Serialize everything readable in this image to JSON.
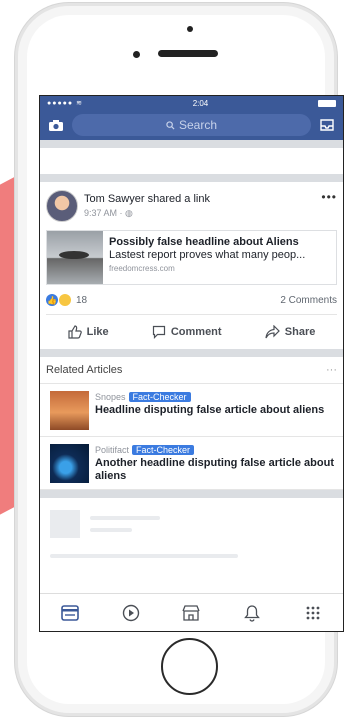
{
  "status": {
    "signal": "●●●●● ≋",
    "time": "2:04"
  },
  "search": {
    "placeholder": "Search"
  },
  "post": {
    "author": "Tom Sawyer",
    "action": "shared a link",
    "time": "9:37 AM · ",
    "link_title": "Possibly false headline about Aliens",
    "link_desc": "Lastest report proves what many peop...",
    "link_source": "freedomcress.com",
    "reaction_count": "18",
    "comments": "2 Comments",
    "like_label": "Like",
    "comment_label": "Comment",
    "share_label": "Share"
  },
  "related": {
    "heading": "Related Articles",
    "more": "···",
    "items": [
      {
        "source": "Snopes",
        "badge": "Fact-Checker",
        "title": "Headline disputing false article about aliens"
      },
      {
        "source": "Politifact",
        "badge": "Fact-Checker",
        "title": "Another headline disputing false article about aliens"
      }
    ]
  },
  "colors": {
    "brand": "#3b5998",
    "accent": "#3b7be0",
    "background_shape": "#f07d7d"
  },
  "icons": [
    "camera-icon",
    "search-icon",
    "messenger-icon",
    "globe-icon",
    "like-icon",
    "comment-icon",
    "share-icon",
    "news-feed-icon",
    "watch-icon",
    "marketplace-icon",
    "notifications-icon",
    "menu-icon"
  ]
}
